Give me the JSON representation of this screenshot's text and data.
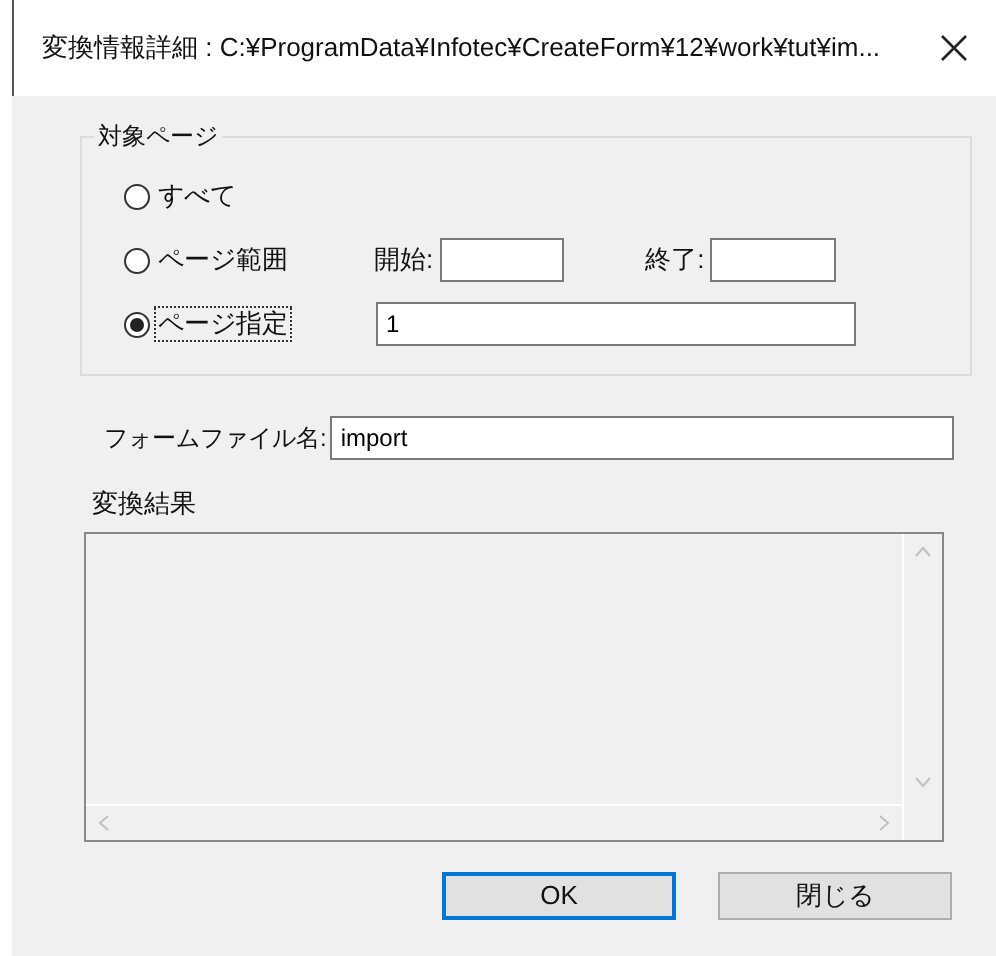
{
  "window": {
    "title": "変換情報詳細 : C:¥ProgramData¥Infotec¥CreateForm¥12¥work¥tut¥im..."
  },
  "target_pages": {
    "label": "対象ページ",
    "options": [
      {
        "kind": "all",
        "label": "すべて",
        "selected": false,
        "focused": false
      },
      {
        "kind": "range",
        "label": "ページ範囲",
        "selected": false,
        "focused": false,
        "start_label": "開始:",
        "end_label": "終了:"
      },
      {
        "kind": "specific",
        "label": "ページ指定",
        "selected": true,
        "focused": true,
        "value": "1"
      }
    ]
  },
  "form_file": {
    "label": "フォームファイル名:",
    "value": "import"
  },
  "result": {
    "label": "変換結果"
  },
  "buttons": [
    {
      "label": "OK",
      "default": true
    },
    {
      "label": "閉じる",
      "default": false
    }
  ]
}
